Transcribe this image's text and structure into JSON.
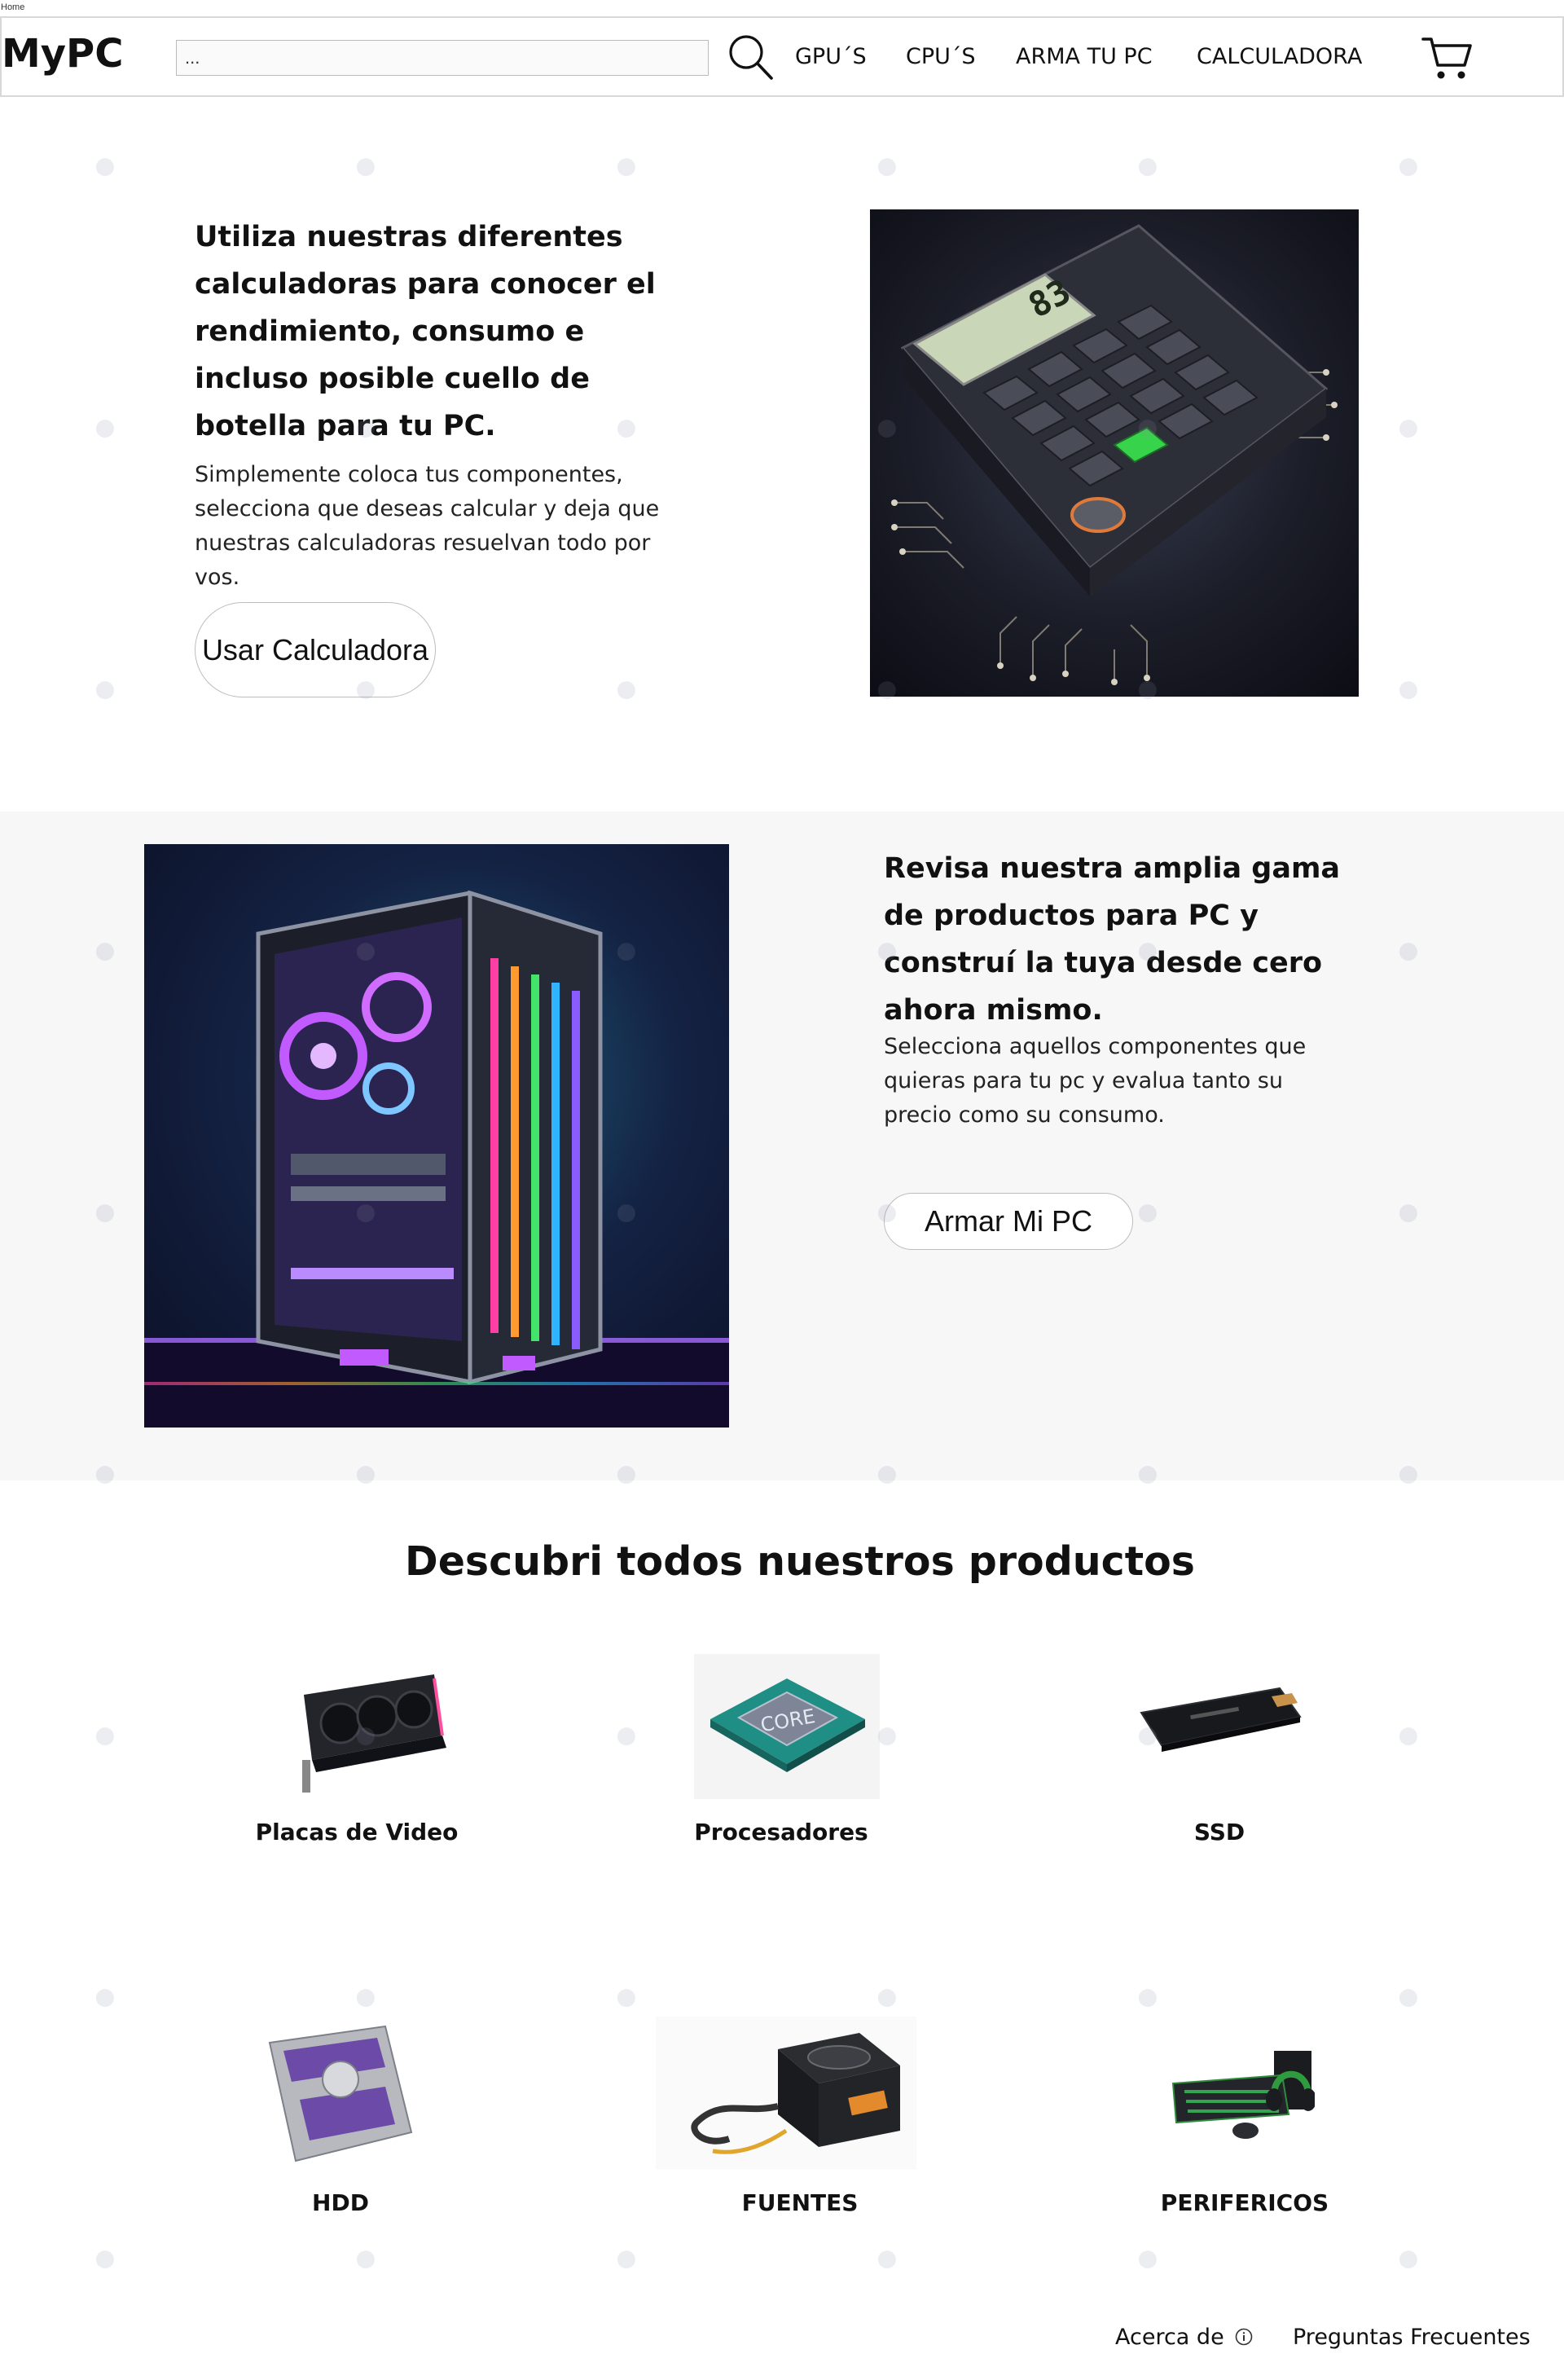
{
  "page": {
    "label": "Home"
  },
  "header": {
    "logo": "MyPC",
    "search": {
      "value": "...",
      "placeholder": ""
    },
    "nav": [
      {
        "label": "GPU´S"
      },
      {
        "label": "CPU´S"
      },
      {
        "label": "ARMA TU PC"
      },
      {
        "label": "CALCULADORA"
      }
    ],
    "icons": {
      "search": "search-icon",
      "cart": "cart-icon"
    }
  },
  "hero_calc": {
    "title": "Utiliza nuestras diferentes calculadoras para conocer el rendimiento, consumo e incluso posible cuello de botella para tu PC.",
    "body": "Simplemente coloca tus componentes, selecciona que deseas calcular y deja que nuestras calculadoras resuelvan todo por vos.",
    "button": "Usar Calculadora",
    "image": {
      "display": "83"
    }
  },
  "hero_build": {
    "title": "Revisa nuestra amplia gama de productos para PC y construí la tuya desde cero ahora mismo.",
    "body": "Selecciona aquellos componentes que quieras para tu pc y evalua tanto su precio como su consumo.",
    "button": "Armar Mi PC"
  },
  "products": {
    "title": "Descubri todos nuestros productos",
    "categories": [
      {
        "label": "Placas de Video",
        "icon": "gpu-image"
      },
      {
        "label": "Procesadores",
        "icon": "cpu-image",
        "chip_text": "CORE"
      },
      {
        "label": "SSD",
        "icon": "ssd-image"
      },
      {
        "label": "HDD",
        "icon": "hdd-image"
      },
      {
        "label": "FUENTES",
        "icon": "psu-image"
      },
      {
        "label": "PERIFERICOS",
        "icon": "peripherals-image"
      }
    ]
  },
  "footer": {
    "links": [
      {
        "label": "Acerca de"
      },
      {
        "label": "Preguntas Frecuentes"
      }
    ],
    "info_icon": "info-icon"
  },
  "colors": {
    "section_alt_bg": "#f7f7f7",
    "text": "#111111",
    "border": "#d8d8d8",
    "watermark": "#8a8fa3"
  }
}
